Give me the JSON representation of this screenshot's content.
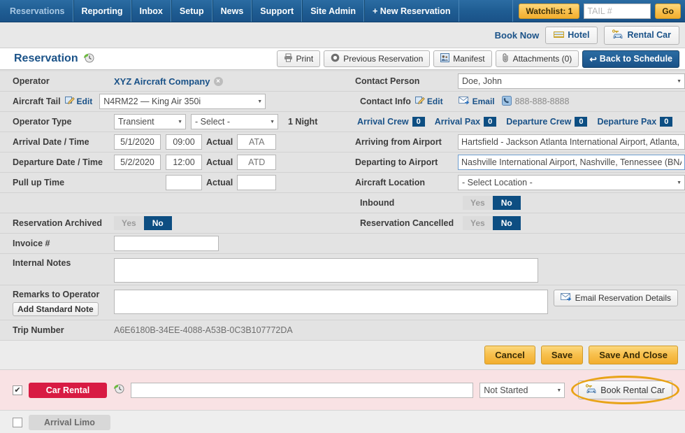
{
  "topnav": {
    "items": [
      {
        "label": "Reservations",
        "active": true
      },
      {
        "label": "Reporting",
        "active": false
      },
      {
        "label": "Inbox",
        "active": false
      },
      {
        "label": "Setup",
        "active": false
      },
      {
        "label": "News",
        "active": false
      },
      {
        "label": "Support",
        "active": false
      },
      {
        "label": "Site Admin",
        "active": false
      },
      {
        "label": "+ New Reservation",
        "active": false
      }
    ],
    "watchlist_label": "Watchlist: 1",
    "tail_placeholder": "TAIL #",
    "tail_value": "",
    "go_label": "Go"
  },
  "booknow": {
    "label": "Book Now",
    "hotel_label": "Hotel",
    "rentalcar_label": "Rental Car"
  },
  "titlebar": {
    "title": "Reservation",
    "print_label": "Print",
    "previous_label": "Previous Reservation",
    "manifest_label": "Manifest",
    "attachments_label": "Attachments (0)",
    "back_label": "Back to Schedule"
  },
  "form": {
    "operator_label": "Operator",
    "operator_value": "XYZ Aircraft Company",
    "contact_person_label": "Contact Person",
    "contact_person_value": "Doe, John",
    "aircraft_tail_label": "Aircraft Tail",
    "edit_label": "Edit",
    "aircraft_tail_value": "N4RM22 — King Air 350i",
    "contact_info_label": "Contact Info",
    "contact_edit_label": "Edit",
    "email_label": "Email",
    "phone_value": "888-888-8888",
    "operator_type_label": "Operator Type",
    "operator_type_value": "Transient",
    "operator_subtype_value": "- Select -",
    "nights_value": "1 Night",
    "arrival_crew_label": "Arrival Crew",
    "arrival_crew_count": "0",
    "arrival_pax_label": "Arrival Pax",
    "arrival_pax_count": "0",
    "departure_crew_label": "Departure Crew",
    "departure_crew_count": "0",
    "departure_pax_label": "Departure Pax",
    "departure_pax_count": "0",
    "arrival_dt_label": "Arrival Date / Time",
    "arrival_date": "5/1/2020",
    "arrival_time": "09:00",
    "actual_label": "Actual",
    "ata_placeholder": "ATA",
    "ata_value": "",
    "arriving_from_label": "Arriving from Airport",
    "arriving_from_value": "Hartsfield - Jackson Atlanta International Airport, Atlanta, Ge",
    "departure_dt_label": "Departure Date / Time",
    "departure_date": "5/2/2020",
    "departure_time": "12:00",
    "atd_placeholder": "ATD",
    "atd_value": "",
    "departing_to_label": "Departing to Airport",
    "departing_to_value": "Nashville International Airport, Nashville, Tennessee (BNA/K",
    "pullup_label": "Pull up Time",
    "pullup_time": "",
    "pullup_actual": "",
    "aircraft_location_label": "Aircraft Location",
    "aircraft_location_value": "- Select Location -",
    "inbound_label": "Inbound",
    "inbound_yes": "Yes",
    "inbound_no": "No",
    "archived_label": "Reservation Archived",
    "archived_yes": "Yes",
    "archived_no": "No",
    "cancelled_label": "Reservation Cancelled",
    "cancelled_yes": "Yes",
    "cancelled_no": "No",
    "invoice_label": "Invoice #",
    "invoice_value": "",
    "internal_notes_label": "Internal Notes",
    "internal_notes_value": "",
    "remarks_label": "Remarks to Operator",
    "add_standard_note_label": "Add Standard Note",
    "remarks_value": "",
    "email_reservation_details_label": "Email Reservation Details",
    "trip_number_label": "Trip Number",
    "trip_number_value": "A6E6180B-34EE-4088-A53B-0C3B107772DA"
  },
  "footer": {
    "cancel_label": "Cancel",
    "save_label": "Save",
    "save_and_close_label": "Save And Close"
  },
  "services": {
    "car_rental": {
      "tag_label": "Car Rental",
      "notes_value": "",
      "status_value": "Not Started",
      "book_label": "Book Rental Car"
    },
    "arrival_limo": {
      "tag_label": "Arrival Limo"
    }
  },
  "colors": {
    "nav_blue": "#1a5288",
    "accent_gold": "#f2ae2e",
    "badge_blue": "#0d4e82",
    "car_rental_red": "#d81b43",
    "highlight_orange": "#e8a317"
  }
}
